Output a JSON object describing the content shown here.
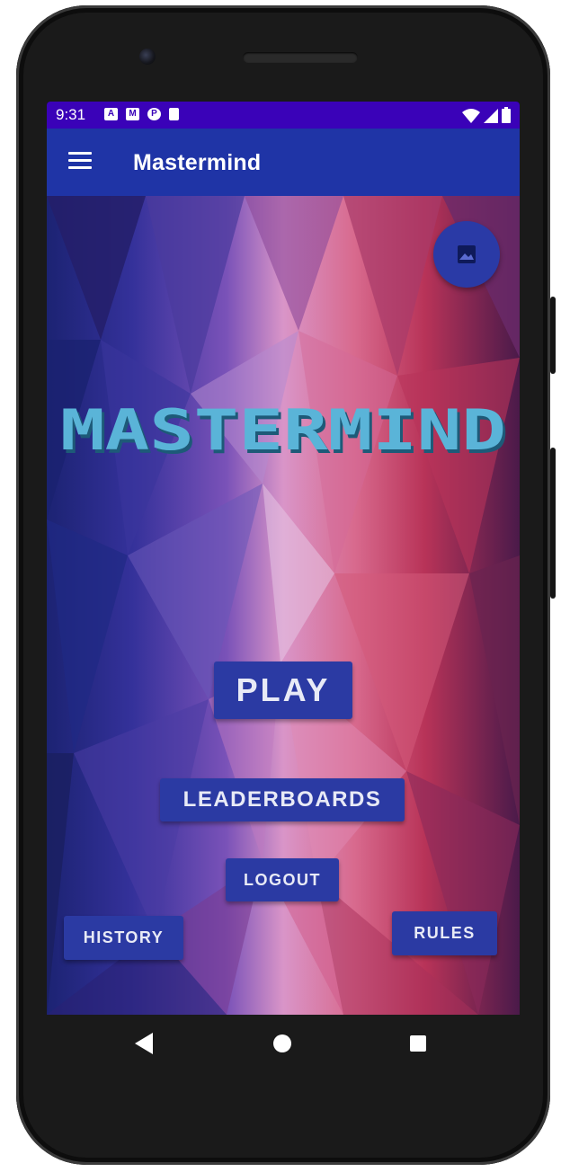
{
  "status_bar": {
    "time": "9:31",
    "left_icons": [
      "a-badge-icon",
      "gmail-icon",
      "app-badge-icon",
      "sd-card-icon"
    ],
    "right_icons": [
      "wifi-icon",
      "signal-icon",
      "battery-icon"
    ],
    "color": "#3a02b8"
  },
  "app_bar": {
    "title": "Mastermind",
    "menu_icon": "hamburger-menu-icon",
    "color": "#1f34a6"
  },
  "main": {
    "logo_text": "MASTERMIND",
    "fab_icon": "image-icon",
    "buttons": {
      "play": "PLAY",
      "leaderboards": "LEADERBOARDS",
      "logout": "LOGOUT",
      "history": "HISTORY",
      "rules": "RULES"
    },
    "button_color": "#2b3aa3",
    "logo_color": "#5ab4d8"
  },
  "nav_bar": {
    "icons": [
      "back-icon",
      "home-icon",
      "recent-apps-icon"
    ]
  }
}
